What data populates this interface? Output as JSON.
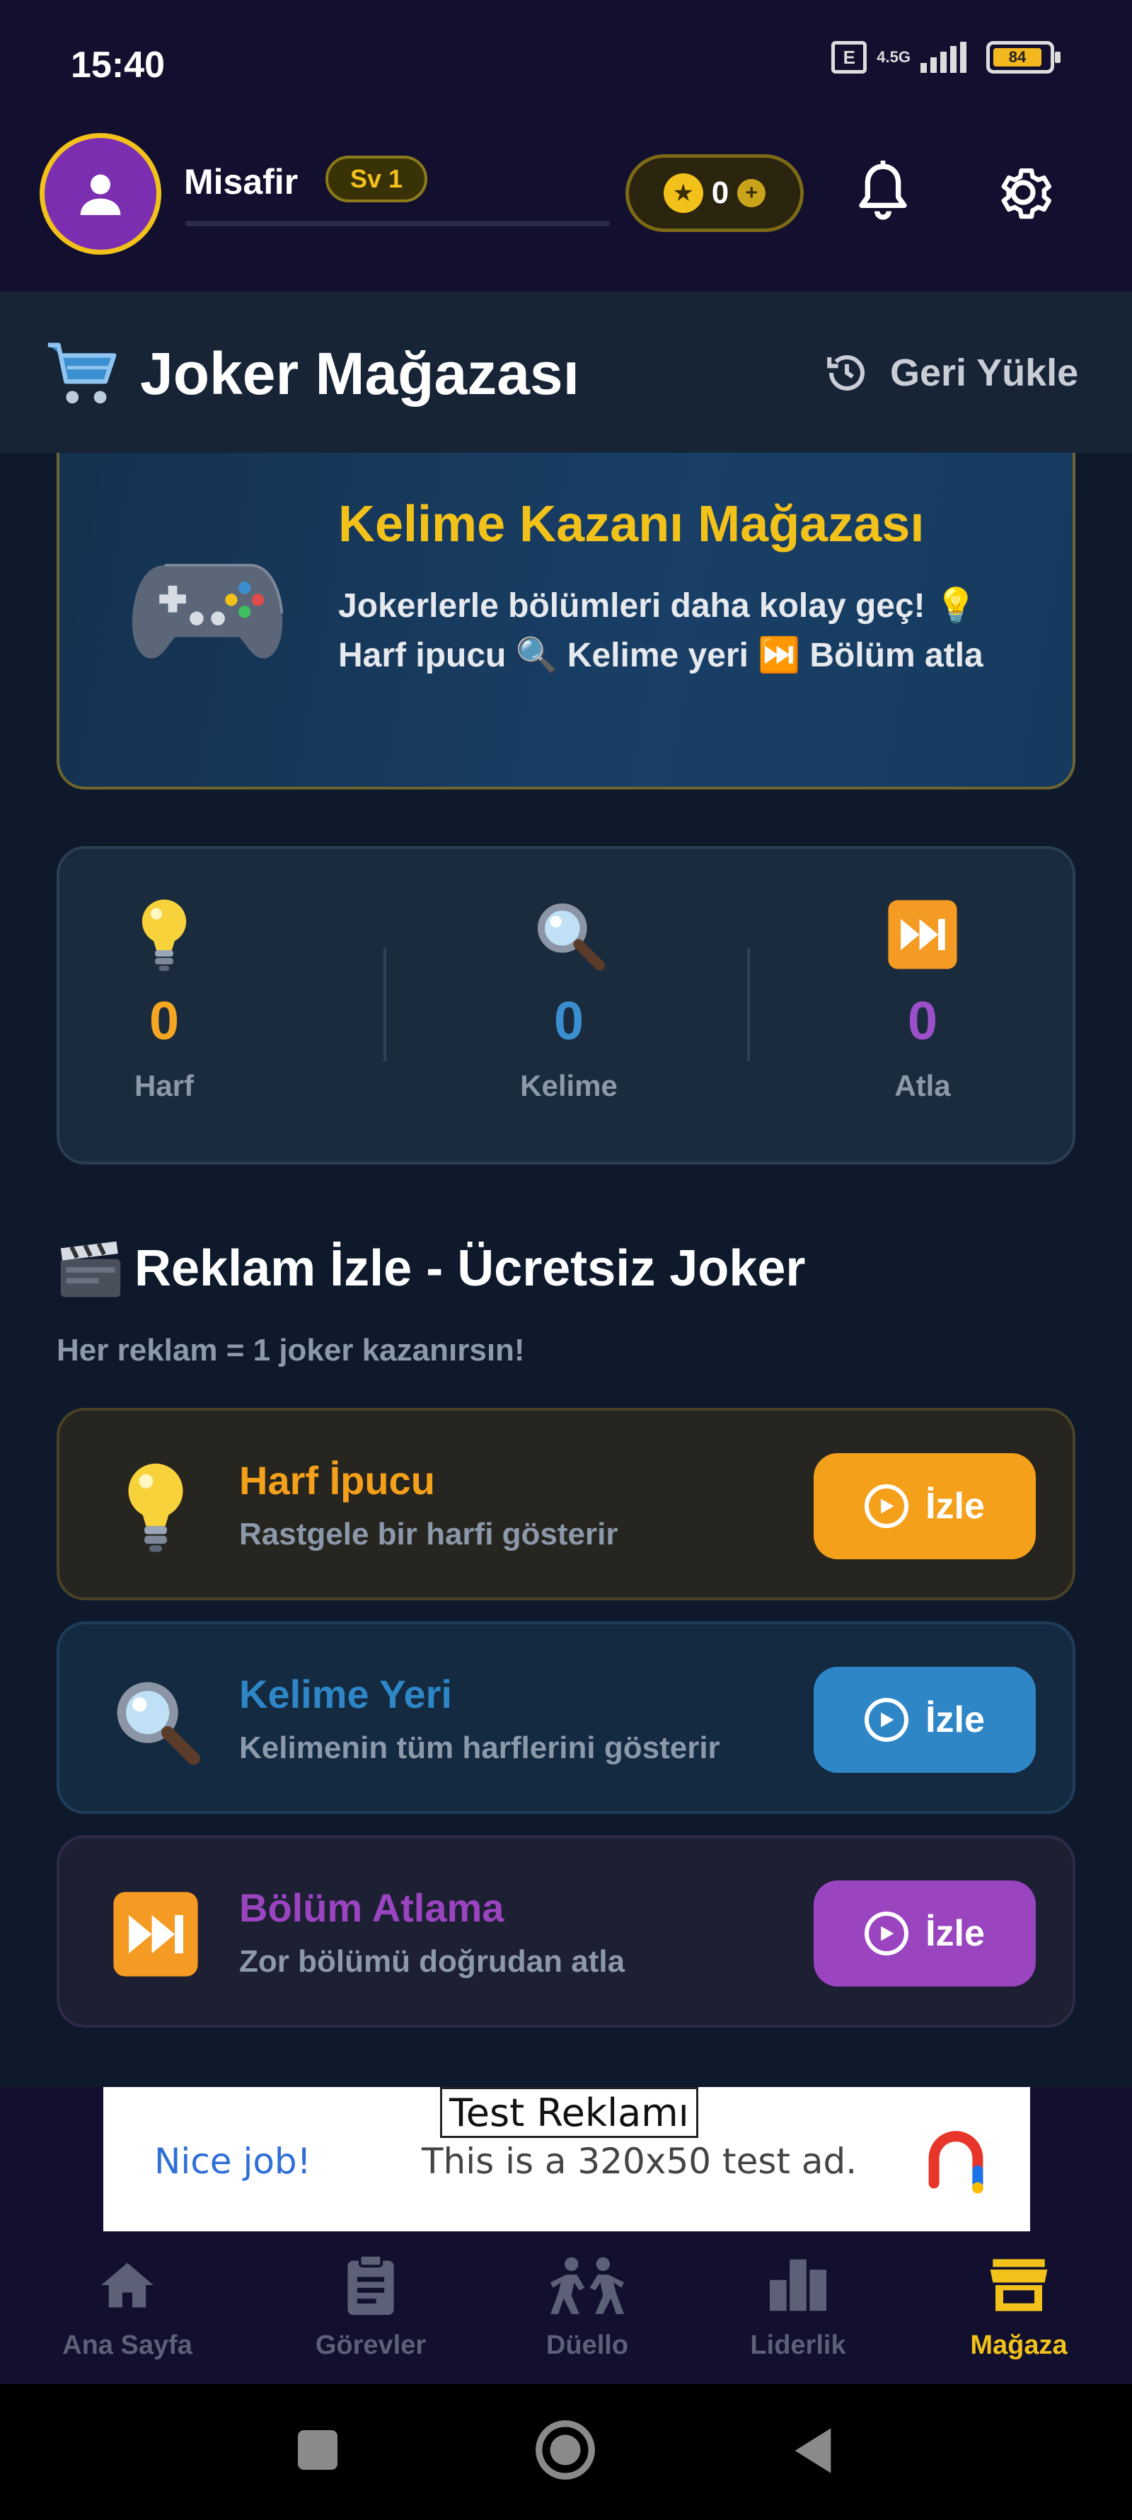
{
  "status_bar": {
    "time": "15:40",
    "network": "4.5G",
    "battery": "84"
  },
  "profile": {
    "name": "Misafir",
    "level": "Sv 1",
    "coins": "0"
  },
  "page": {
    "title": "Joker Mağazası",
    "restore_label": "Geri Yükle"
  },
  "banner": {
    "title": "Kelime Kazanı Mağazası",
    "description": "Jokerlerle bölümleri daha kolay geç! 💡 Harf ipucu 🔍 Kelime yeri ⏭️ Bölüm atla"
  },
  "stats": [
    {
      "icon": "💡",
      "value": "0",
      "label": "Harf",
      "color": "#f5a623"
    },
    {
      "icon": "🔍",
      "value": "0",
      "label": "Kelime",
      "color": "#3b8fd0"
    },
    {
      "icon": "⏭️",
      "value": "0",
      "label": "Atla",
      "color": "#9b4fc9"
    }
  ],
  "ads_section": {
    "icon": "🎬",
    "title": "Reklam İzle - Ücretsiz Joker",
    "subtitle": "Her reklam = 1 joker kazanırsın!"
  },
  "rewards": [
    {
      "icon": "💡",
      "title": "Harf İpucu",
      "desc": "Rastgele bir harfi gösterir",
      "button": "İzle",
      "color": "#f5a01a",
      "bg": "#262520",
      "border": "#4b4226"
    },
    {
      "icon": "🔍",
      "title": "Kelime Yeri",
      "desc": "Kelimenin tüm harflerini gösterir",
      "button": "İzle",
      "color": "#2e86c7",
      "bg": "#142a40",
      "border": "#1f3d5a"
    },
    {
      "icon": "⏭️",
      "title": "Bölüm Atlama",
      "desc": "Zor bölümü doğrudan atla",
      "button": "İzle",
      "color": "#9a44c0",
      "bg": "#1d1f33",
      "border": "#2e2b4a"
    }
  ],
  "ad": {
    "tag": "Test Reklamı",
    "cta": "Nice job!",
    "text": "This is a 320x50 test ad."
  },
  "bottom_nav": [
    {
      "label": "Ana Sayfa",
      "icon": "home-icon"
    },
    {
      "label": "Görevler",
      "icon": "clipboard-icon"
    },
    {
      "label": "Düello",
      "icon": "duel-icon"
    },
    {
      "label": "Liderlik",
      "icon": "leaderboard-icon"
    },
    {
      "label": "Mağaza",
      "icon": "store-icon",
      "active": true
    }
  ],
  "colors": {
    "accent": "#f2c21b",
    "background": "#0e1a2b",
    "header": "#12102e"
  }
}
